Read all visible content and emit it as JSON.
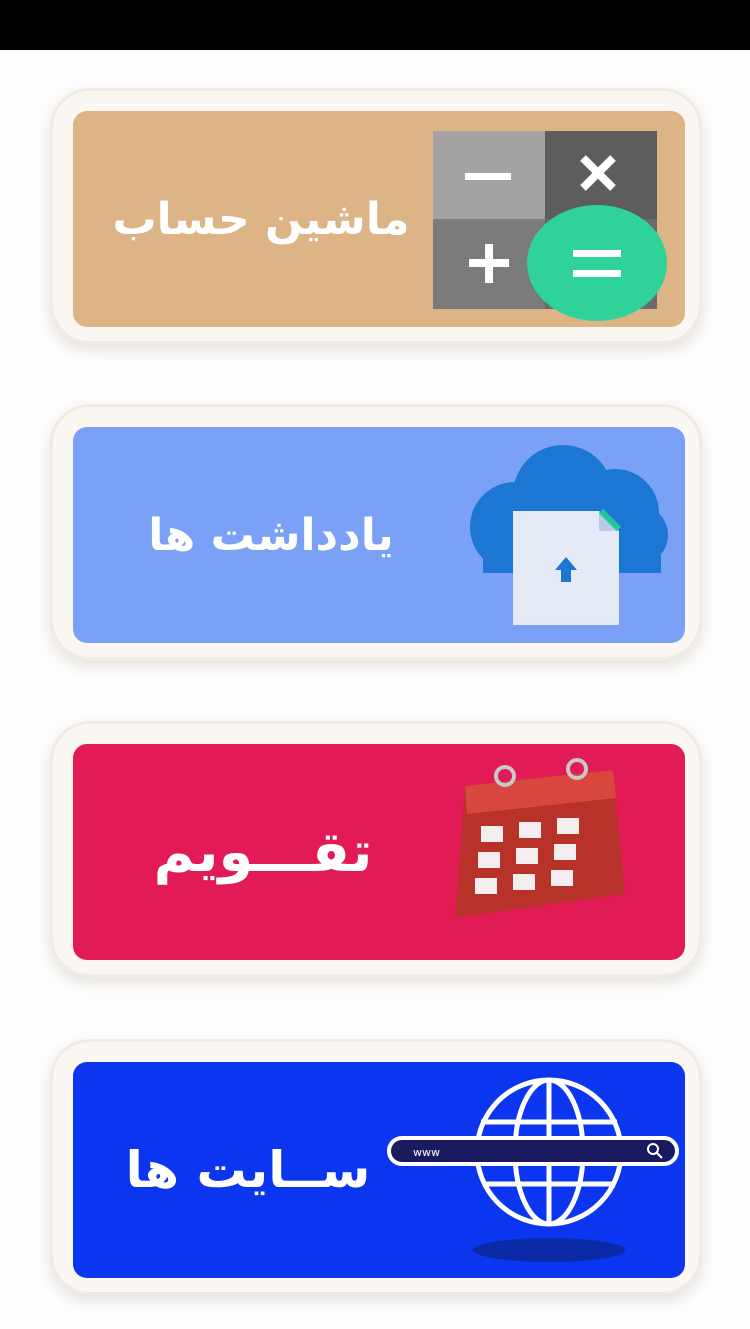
{
  "app": {
    "cards": [
      {
        "id": "calculator",
        "label": "ماشین حساب",
        "color": "#dcb486",
        "icon": "calculator-icon"
      },
      {
        "id": "notes",
        "label": "یادداشت ها",
        "color": "#7aa1f6",
        "icon": "cloud-upload-icon"
      },
      {
        "id": "calendar",
        "label": "تقـــویم",
        "color": "#e21a55",
        "icon": "calendar-icon"
      },
      {
        "id": "websites",
        "label": "ســایت ها",
        "color": "#0b35ee",
        "icon": "globe-icon"
      }
    ],
    "browser_bar_text": "www"
  }
}
